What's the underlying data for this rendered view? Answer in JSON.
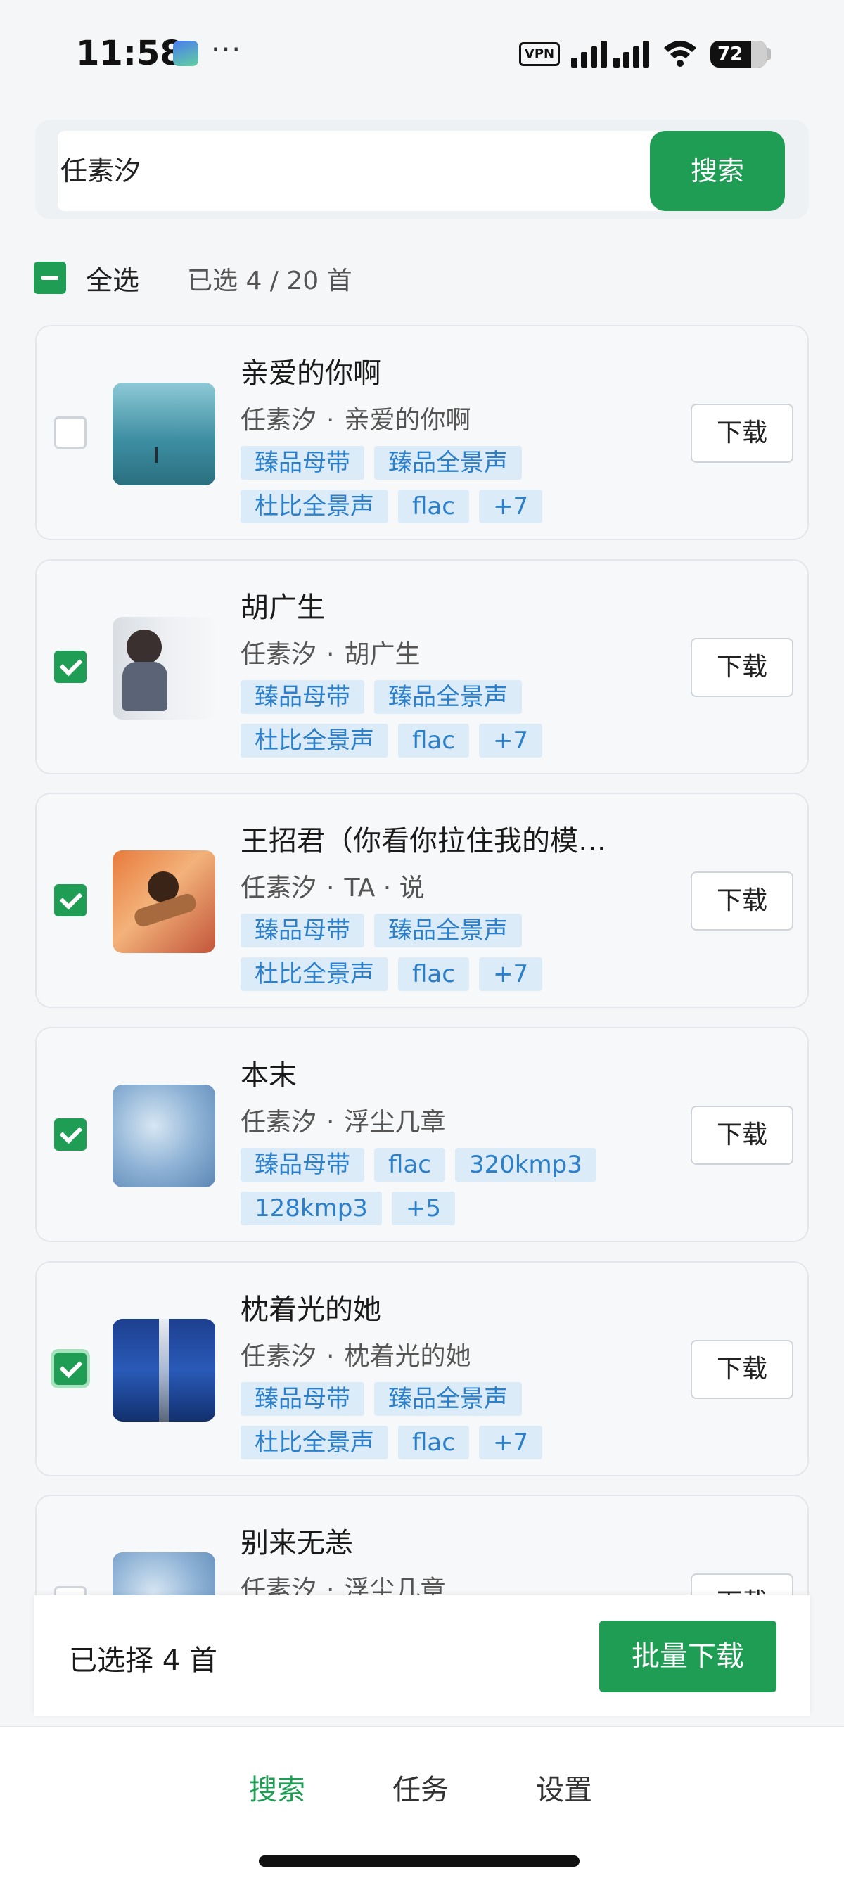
{
  "status_bar": {
    "time": "11:58",
    "more": "···",
    "vpn": "VPN",
    "battery": "72"
  },
  "search": {
    "query": "任素汐",
    "button_label": "搜索"
  },
  "selection": {
    "select_all_label": "全选",
    "count_label": "已选 4 / 20 首"
  },
  "songs": [
    {
      "title": "亲爱的你啊",
      "artist": "任素汐",
      "separator": "·",
      "album": "亲爱的你啊",
      "checked": false,
      "tags": [
        "臻品母带",
        "臻品全景声",
        "杜比全景声",
        "flac",
        "+7"
      ],
      "download_label": "下载"
    },
    {
      "title": "胡广生",
      "artist": "任素汐",
      "separator": "·",
      "album": "胡广生",
      "checked": true,
      "tags": [
        "臻品母带",
        "臻品全景声",
        "杜比全景声",
        "flac",
        "+7"
      ],
      "download_label": "下载"
    },
    {
      "title": "王招君（你看你拉住我的模…",
      "artist": "任素汐",
      "separator": "·",
      "album": "TA · 说",
      "checked": true,
      "tags": [
        "臻品母带",
        "臻品全景声",
        "杜比全景声",
        "flac",
        "+7"
      ],
      "download_label": "下载"
    },
    {
      "title": "本末",
      "artist": "任素汐",
      "separator": "·",
      "album": "浮尘几章",
      "checked": true,
      "tags": [
        "臻品母带",
        "flac",
        "320kmp3",
        "128kmp3",
        "+5"
      ],
      "download_label": "下载"
    },
    {
      "title": "枕着光的她",
      "artist": "任素汐",
      "separator": "·",
      "album": "枕着光的她",
      "checked": true,
      "tags": [
        "臻品母带",
        "臻品全景声",
        "杜比全景声",
        "flac",
        "+7"
      ],
      "download_label": "下载"
    },
    {
      "title": "别来无恙",
      "artist": "任素汐",
      "separator": "·",
      "album": "浮尘几章",
      "checked": false,
      "tags": [],
      "download_label": "下载"
    }
  ],
  "action_bar": {
    "selected_label": "已选择 4 首",
    "batch_button_label": "批量下载"
  },
  "tabs": [
    {
      "label": "搜索",
      "active": true
    },
    {
      "label": "任务",
      "active": false
    },
    {
      "label": "设置",
      "active": false
    }
  ],
  "colors": {
    "accent": "#1f9d55",
    "tag_bg": "#dcebf8",
    "tag_text": "#2c7fc9"
  }
}
